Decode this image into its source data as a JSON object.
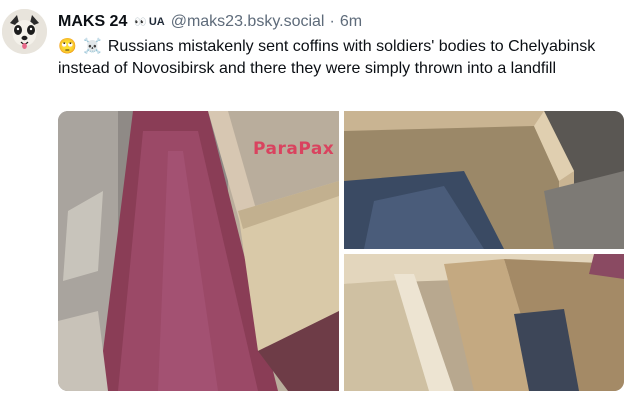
{
  "post": {
    "author": {
      "display_name": "MAKS 24",
      "badge_emoji": "👀",
      "badge_text": "UA",
      "handle": "@maks23.bsky.social",
      "separator": "·",
      "time_ago": "6m",
      "avatar_icon": "dog-avatar-icon"
    },
    "text": {
      "emoji_1": "🙄",
      "emoji_2": "☠️",
      "body": "Russians mistakenly sent coffins with soldiers' bodies to Chelyabinsk instead of Novosibirsk and there they were simply thrown into a landfill"
    },
    "media": {
      "count": 3,
      "watermark": "ParaPax"
    }
  }
}
